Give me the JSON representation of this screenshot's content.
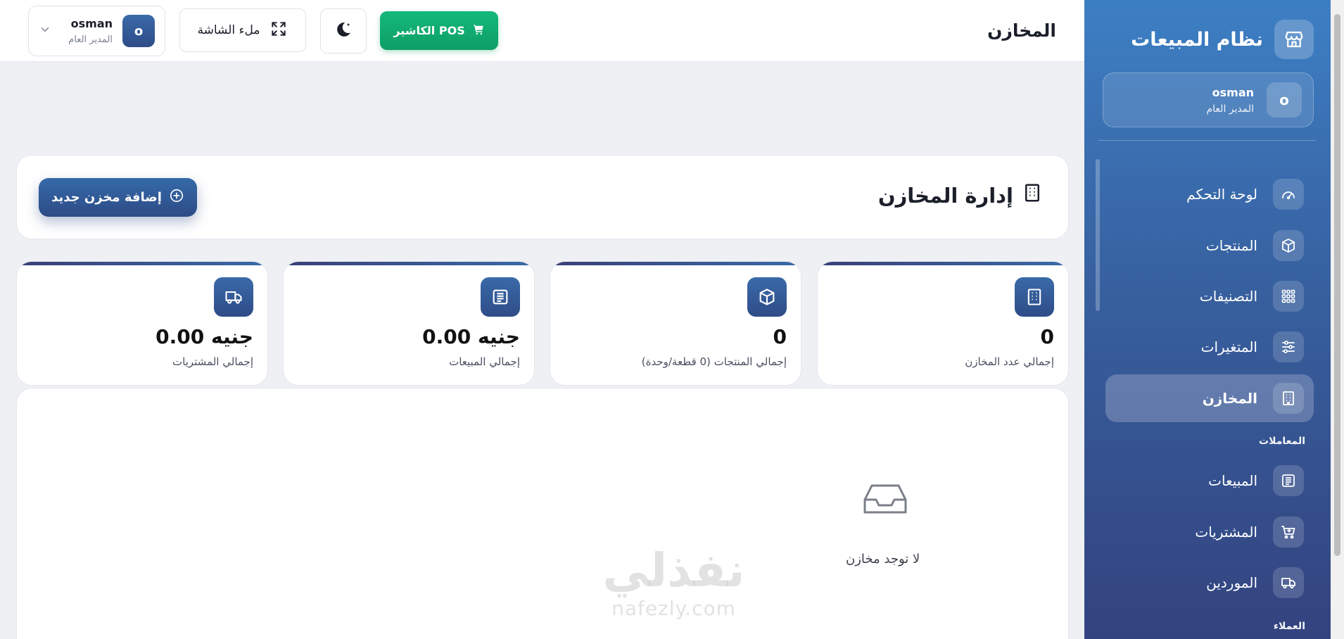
{
  "header": {
    "page_title": "المخازن",
    "pos_button_label": "الكاشير POS",
    "fullscreen_label": "ملء الشاشة",
    "user": {
      "avatar_letter": "o",
      "name": "osman",
      "role": "المدير العام"
    }
  },
  "sidebar": {
    "brand_title": "نظام المبيعات",
    "user": {
      "avatar_letter": "o",
      "name": "osman",
      "role": "المدير العام"
    },
    "items": [
      {
        "label": "لوحة التحكم",
        "icon": "gauge-icon"
      },
      {
        "label": "المنتجات",
        "icon": "box-icon"
      },
      {
        "label": "التصنيفات",
        "icon": "grid-icon"
      },
      {
        "label": "المتغيرات",
        "icon": "sliders-icon"
      },
      {
        "label": "المخازن",
        "icon": "building-icon",
        "active": true
      }
    ],
    "section_transactions": "المعاملات",
    "transaction_items": [
      {
        "label": "المبيعات",
        "icon": "receipt-icon"
      },
      {
        "label": "المشتريات",
        "icon": "cart-icon"
      },
      {
        "label": "الموردين",
        "icon": "truck-icon"
      }
    ],
    "section_customers": "العملاء"
  },
  "main": {
    "title": "إدارة المخازن",
    "add_button_label": "إضافة مخزن جديد",
    "stats": [
      {
        "value": "0",
        "label": "إجمالي عدد المخازن",
        "icon": "building-icon"
      },
      {
        "value": "0",
        "label": "إجمالي المنتجات (0 قطعة/وحدة)",
        "icon": "box-icon"
      },
      {
        "value": "0.00 جنيه",
        "label": "إجمالي المبيعات",
        "icon": "receipt-icon"
      },
      {
        "value": "0.00 جنيه",
        "label": "إجمالي المشتريات",
        "icon": "truck-icon"
      }
    ],
    "empty_text": "لا توجد مخازن"
  },
  "watermark": {
    "arabic": "نفذلي",
    "latin": "nafezly.com"
  },
  "colors": {
    "primary": "#2e4c88",
    "accent_green": "#0d9e66",
    "sidebar_top": "#3d7fc4",
    "sidebar_bottom": "#33437f"
  }
}
